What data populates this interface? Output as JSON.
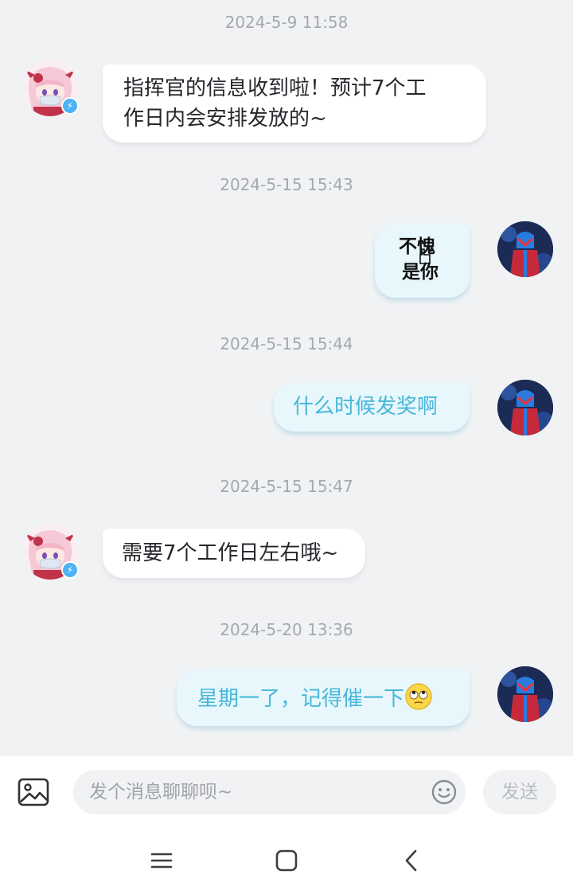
{
  "messages": [
    {
      "timestamp": "2024-5-9 11:58",
      "sender": "bot",
      "text_line1": "指挥官的信息收到啦！预计7个工",
      "text_line2": "作日内会安排发放的~"
    },
    {
      "timestamp": "2024-5-15 15:43",
      "sender": "user",
      "sticker_line1": "不愧",
      "sticker_line2": "是你"
    },
    {
      "timestamp": "2024-5-15 15:44",
      "sender": "user",
      "text": "什么时候发奖啊"
    },
    {
      "timestamp": "2024-5-15 15:47",
      "sender": "bot",
      "text": "需要7个工作日左右哦~"
    },
    {
      "timestamp": "2024-5-20 13:36",
      "sender": "user",
      "text": "星期一了，记得催一下",
      "emoji": "rolling-eyes-emoji"
    }
  ],
  "composer": {
    "placeholder": "发个消息聊聊呗~",
    "send_label": "发送"
  },
  "colors": {
    "background": "#f1f2f4",
    "incoming_bubble": "#ffffff",
    "outgoing_bubble": "#e7f7fc",
    "outgoing_text": "#48b7d9",
    "badge": "#4cb3f4"
  }
}
